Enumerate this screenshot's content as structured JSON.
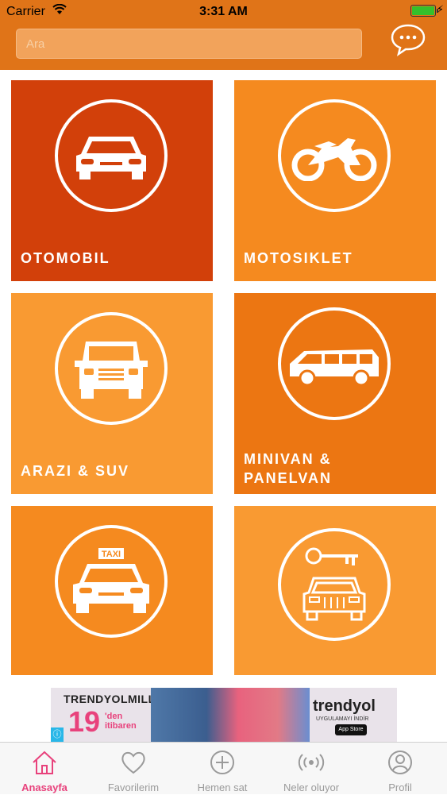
{
  "status_bar": {
    "carrier": "Carrier",
    "time": "3:31 AM"
  },
  "header": {
    "search_placeholder": "Ara",
    "chat_icon": "chat-bubble-icon",
    "background": "#e07418"
  },
  "categories": [
    {
      "label": "OTOMOBIL",
      "icon": "car-icon",
      "color": "#d2400a"
    },
    {
      "label": "MOTOSIKLET",
      "icon": "motorcycle-icon",
      "color": "#f58a1f"
    },
    {
      "label": "ARAZI & SUV",
      "icon": "suv-icon",
      "color": "#f99a32"
    },
    {
      "label": "MINIVAN &\nPANELVAN",
      "icon": "van-icon",
      "color": "#ec7612"
    },
    {
      "label": "",
      "icon": "taxi-icon",
      "color": "#f58a1f"
    },
    {
      "label": "",
      "icon": "rental-car-key-icon",
      "color": "#f99a32"
    }
  ],
  "ad": {
    "brand_left": "TRENDYOLMILLA",
    "big_number": "19",
    "small_text": "'den\nitibaren",
    "brand_right": "trendyol",
    "brand_right_sub": "UYGULAMAYI İNDİR",
    "store": "App Store"
  },
  "tabs": [
    {
      "label": "Anasayfa",
      "icon": "home-icon",
      "active": true
    },
    {
      "label": "Favorilerim",
      "icon": "heart-icon",
      "active": false
    },
    {
      "label": "Hemen sat",
      "icon": "plus-circle-icon",
      "active": false
    },
    {
      "label": "Neler oluyor",
      "icon": "broadcast-icon",
      "active": false
    },
    {
      "label": "Profil",
      "icon": "profile-icon",
      "active": false
    }
  ],
  "colors": {
    "accent": "#e8427c",
    "tab_inactive": "#9a9a9a"
  }
}
